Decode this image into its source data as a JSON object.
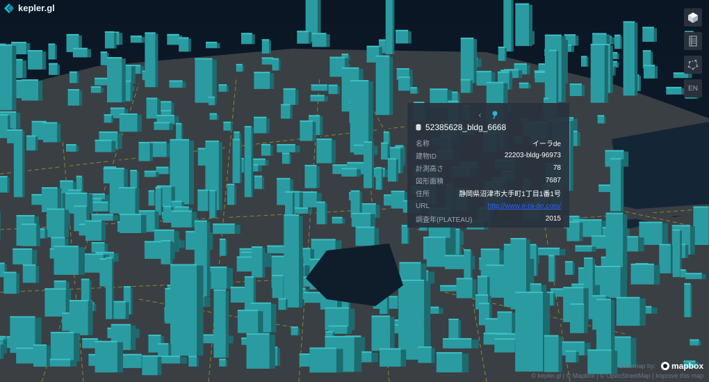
{
  "app": {
    "name": "kepler.gl"
  },
  "colors": {
    "building": "#2a9ba1",
    "building_dark": "#1d6b6f",
    "road": "#3a3f44",
    "road_line": "#8a8a2a",
    "background": "#0d1a28",
    "accent": "#2fb3d9"
  },
  "controls": [
    {
      "name": "3d-view-icon",
      "label": ""
    },
    {
      "name": "legend-icon",
      "label": ""
    },
    {
      "name": "draw-polygon-icon",
      "label": ""
    },
    {
      "name": "language-button",
      "label": "EN"
    }
  ],
  "tooltip": {
    "title": "52385628_bldg_6668",
    "rows": [
      {
        "key": "名称",
        "value": "イーラde"
      },
      {
        "key": "建物ID",
        "value": "22203-bldg-96973"
      },
      {
        "key": "計測高さ",
        "value": "78"
      },
      {
        "key": "図形面積",
        "value": "7687"
      },
      {
        "key": "住所",
        "value": "静岡県沼津市大手町1丁目1番1号"
      },
      {
        "key": "URL",
        "value": "http://www.e-ra-de.com/"
      },
      {
        "key": "調査年(PLATEAU)",
        "value": "2015"
      }
    ]
  },
  "footer": {
    "basemap_label": "Basemap by:",
    "mapbox": "mapbox",
    "attribution": "© kepler.gl | © Mapbox | © OpenStreetMap | Improve this map"
  }
}
